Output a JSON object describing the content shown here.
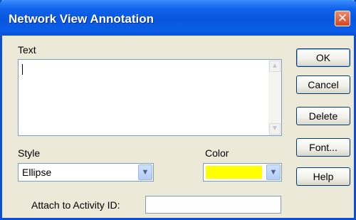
{
  "window": {
    "title": "Network View Annotation",
    "close_glyph": "✕"
  },
  "text_section": {
    "label": "Text",
    "value": ""
  },
  "style": {
    "label": "Style",
    "selected": "Ellipse"
  },
  "color": {
    "label": "Color",
    "selected_hex": "#ffff00"
  },
  "attach": {
    "label": "Attach to Activity ID:",
    "value": ""
  },
  "buttons": {
    "ok": "OK",
    "cancel": "Cancel",
    "delete": "Delete",
    "font": "Font...",
    "help": "Help"
  },
  "icons": {
    "dropdown": "chevron-down-icon",
    "scroll_up": "scroll-up-arrow-icon",
    "scroll_down": "scroll-down-arrow-icon",
    "close": "close-icon"
  }
}
